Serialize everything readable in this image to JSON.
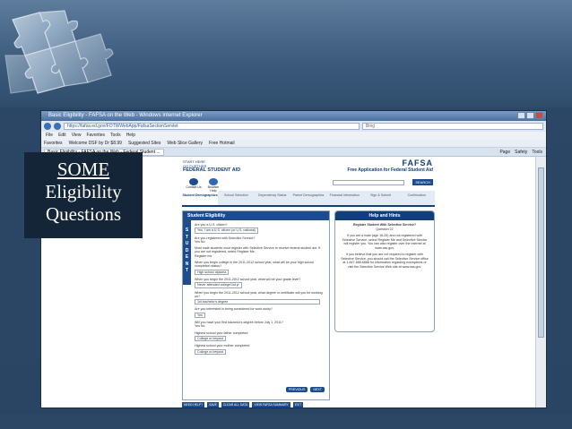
{
  "overlay": {
    "line1": "SOME",
    "line2": "Eligibility",
    "line3": "Questions"
  },
  "browser": {
    "title": "Basic Eligibility - FAFSA on the Web - Windows Internet Explorer",
    "address": "https://fafsa.ed.gov/FOTWWebApp/FafsaSectionServlet",
    "search_placeholder": "Bing",
    "menu": [
      "File",
      "Edit",
      "View",
      "Favorites",
      "Tools",
      "Help"
    ],
    "favorites": [
      "Favorites",
      "Welcome DSF by Dr $8.99",
      "Suggested Sites",
      "Web Slice Gallery",
      "Free Hotmail"
    ],
    "tab": "Basic Eligibility - FAFSA on the Web - Federal Student ...",
    "tools": [
      "Page",
      "Safety",
      "Tools"
    ]
  },
  "fafsa": {
    "logo_line1": "START HERE",
    "logo_line2": "GO FURTHER",
    "logo_line3": "FEDERAL STUDENT AID",
    "brand": "FAFSA",
    "subtitle": "Free Application for Federal Student Aid",
    "contact": "Contact Us",
    "help": "Browser Help",
    "search_btn": "SEARCH",
    "steps": [
      "Student Demographics",
      "School Selection",
      "Dependency Status",
      "Parent Demographics",
      "Financial Information",
      "Sign & Submit",
      "Confirmation"
    ],
    "section_title": "Student Eligibility",
    "side_letters": [
      "S",
      "T",
      "U",
      "D",
      "E",
      "N",
      "T"
    ],
    "questions": [
      {
        "q": "Are you a U.S. citizen?",
        "a": "Yes, I am a U.S. citizen (or U.S. national)"
      },
      {
        "q": "Are you registered with Selective Service?",
        "a": "Yes     No"
      },
      {
        "q": "Most male students must register with Selective Service to receive federal student aid. If you are not registered, select Register Me.",
        "a": "Register me"
      },
      {
        "q": "When you begin college in the 2011-2012 school year, what will be your high school completion status?",
        "a": "High school diploma"
      },
      {
        "q": "When you begin the 2011-2012 school year, what will be your grade level?",
        "a": "Never attended college/1st yr"
      },
      {
        "q": "When you begin the 2011-2012 school year, what degree or certificate will you be working on?",
        "a": "1st bachelor's degree"
      },
      {
        "q": "Are you interested in being considered for work-study?",
        "a": "Yes"
      },
      {
        "q": "Will you have your first bachelor's degree before July 1, 2011?",
        "a": "Yes     No"
      },
      {
        "q": "Highest school your father completed",
        "a": "College or beyond"
      },
      {
        "q": "Highest school your mother completed",
        "a": "College or beyond"
      }
    ],
    "prev_btn": "PREVIOUS",
    "next_btn": "NEXT",
    "bottom_btns": [
      "NEED HELP?",
      "SAVE",
      "CLEAR ALL DATA",
      "VIEW FAFSA SUMMARY",
      "EXIT"
    ],
    "help_title": "Help and Hints",
    "help_subtitle": "Register Student With Selective Service?",
    "help_q": "Question 22",
    "help_text1": "If you are a male (age 18-25) and not registered with Selective Service, select Register Me and Selective Service will register you. You can also register over the Internet at www.sss.gov.",
    "help_text2": "If you believe that you are not required to register with Selective Service, you should call the Selective Service office at 1-847-688-6888 for information regarding exemptions or visit the Selective Service Web site at www.sss.gov.",
    "footer": "Page last updated: July 4, 2011"
  }
}
